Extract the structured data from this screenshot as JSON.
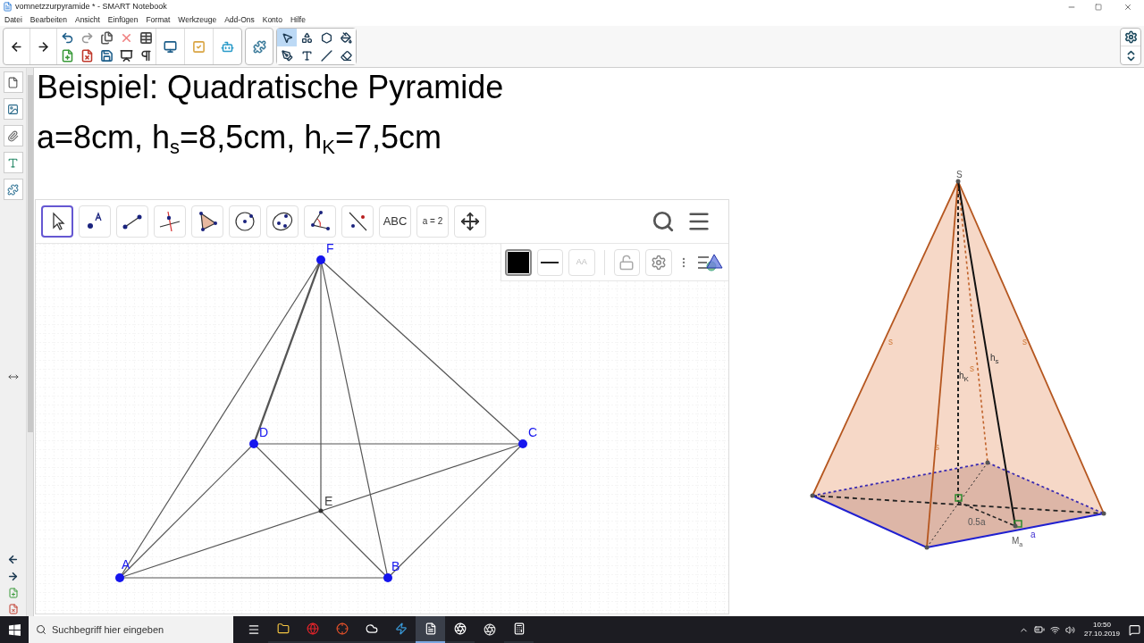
{
  "window": {
    "title": "vomnetzzurpyramide * - SMART Notebook"
  },
  "menu": [
    "Datei",
    "Bearbeiten",
    "Ansicht",
    "Einfügen",
    "Format",
    "Werkzeuge",
    "Add-Ons",
    "Konto",
    "Hilfe"
  ],
  "toolbar": {
    "tools": [
      {
        "kind": "select",
        "selected": true
      },
      {
        "kind": "shapes",
        "selected": false
      },
      {
        "kind": "polygon",
        "selected": false
      },
      {
        "kind": "fill",
        "selected": false
      },
      {
        "kind": "pens",
        "selected": false
      },
      {
        "kind": "text",
        "selected": false
      },
      {
        "kind": "line",
        "selected": false
      },
      {
        "kind": "eraser",
        "selected": false
      }
    ]
  },
  "page": {
    "heading": "Beispiel: Quadratische Pyramide",
    "given": "a=8cm, h$_{s}$=8,5cm, h$_{K}$=7,5cm"
  },
  "geogebra": {
    "tools": [
      {
        "kind": "move",
        "selected": true
      },
      {
        "kind": "point",
        "selected": false
      },
      {
        "kind": "segment",
        "selected": false
      },
      {
        "kind": "perpendicular",
        "selected": false
      },
      {
        "kind": "polygon",
        "selected": false
      },
      {
        "kind": "circle",
        "selected": false
      },
      {
        "kind": "ellipse",
        "selected": false
      },
      {
        "kind": "angle",
        "selected": false
      },
      {
        "kind": "reflect",
        "selected": false
      },
      {
        "kind": "text",
        "label": "ABC",
        "selected": false
      },
      {
        "kind": "slider",
        "label": "a = 2",
        "selected": false
      },
      {
        "kind": "pan",
        "selected": false
      }
    ],
    "style_bar": {
      "text_size": "AA"
    },
    "points": [
      {
        "label": "F"
      },
      {
        "label": "D"
      },
      {
        "label": "C"
      },
      {
        "label": "E"
      },
      {
        "label": "A"
      },
      {
        "label": "B"
      }
    ]
  },
  "pyramid": {
    "apex": "S",
    "edge_labels": [
      "s",
      "s",
      "s",
      "s"
    ],
    "heights": [
      {
        "main": "h",
        "sub": "K"
      },
      {
        "main": "h",
        "sub": "s"
      }
    ],
    "half_side": "0.5a",
    "midpoint": {
      "main": "M",
      "sub": "a"
    },
    "side": "a"
  },
  "taskbar": {
    "search_placeholder": "Suchbegriff hier eingeben",
    "time": "10:50",
    "date": "27.10.2019"
  }
}
